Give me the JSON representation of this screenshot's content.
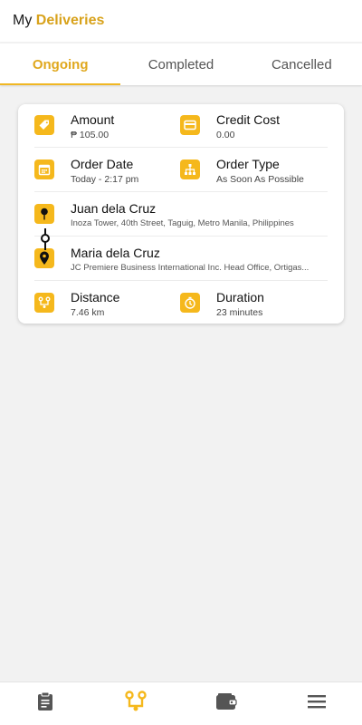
{
  "header": {
    "title_prefix": "My",
    "title_accent": "Deliveries"
  },
  "tabs": [
    {
      "label": "Ongoing",
      "active": true
    },
    {
      "label": "Completed",
      "active": false
    },
    {
      "label": "Cancelled",
      "active": false
    }
  ],
  "delivery": {
    "amount": {
      "label": "Amount",
      "value": "₱ 105.00",
      "icon": "price-tag-icon"
    },
    "credit_cost": {
      "label": "Credit Cost",
      "value": "0.00",
      "icon": "credit-card-icon"
    },
    "order_date": {
      "label": "Order Date",
      "value": "Today - 2:17 pm",
      "icon": "calendar-icon"
    },
    "order_type": {
      "label": "Order Type",
      "value": "As Soon As Possible",
      "icon": "hierarchy-icon"
    },
    "pickup": {
      "name": "Juan dela Cruz",
      "address": "Inoza Tower, 40th Street, Taguig, Metro Manila, Philippines",
      "icon": "pickup-pin-icon"
    },
    "dropoff": {
      "name": "Maria dela Cruz",
      "address": "JC Premiere Business International Inc. Head Office, Ortigas...",
      "icon": "dropoff-pin-icon"
    },
    "distance": {
      "label": "Distance",
      "value": "7.46 km",
      "icon": "route-icon"
    },
    "duration": {
      "label": "Duration",
      "value": "23 minutes",
      "icon": "stopwatch-icon"
    }
  },
  "bottom_nav": [
    {
      "icon": "clipboard-icon",
      "active": false
    },
    {
      "icon": "route-icon",
      "active": true
    },
    {
      "icon": "wallet-icon",
      "active": false
    },
    {
      "icon": "menu-icon",
      "active": false
    }
  ],
  "colors": {
    "accent": "#f5b81c",
    "accent_text": "#d8a21b",
    "background": "#f2f2f2"
  }
}
